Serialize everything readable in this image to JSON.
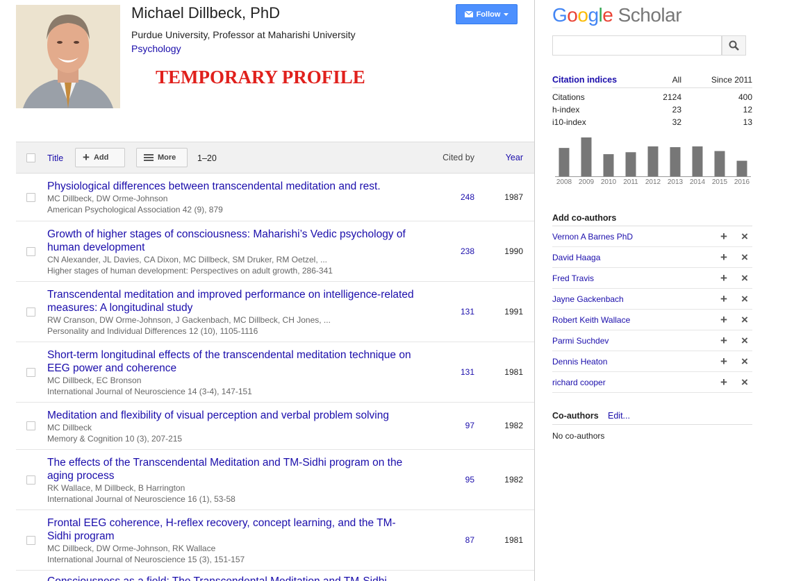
{
  "profile": {
    "name": "Michael Dillbeck, PhD",
    "affiliation": "Purdue University, Professor at Maharishi University",
    "interest": "Psychology",
    "overlay_text": "TEMPORARY PROFILE",
    "follow_label": "Follow"
  },
  "table": {
    "col_title": "Title",
    "add_label": "Add",
    "more_label": "More",
    "range": "1–20",
    "col_cited": "Cited by",
    "col_year": "Year",
    "rows": [
      {
        "title": "Physiological differences between transcendental meditation and rest.",
        "authors": "MC Dillbeck, DW Orme-Johnson",
        "venue": "American Psychological Association 42 (9), 879",
        "cited": "248",
        "year": "1987"
      },
      {
        "title": "Growth of higher stages of consciousness: Maharishi’s Vedic psychology of human development",
        "authors": "CN Alexander, JL Davies, CA Dixon, MC Dillbeck, SM Druker, RM Oetzel, ...",
        "venue": "Higher stages of human development: Perspectives on adult growth, 286-341",
        "cited": "238",
        "year": "1990"
      },
      {
        "title": "Transcendental meditation and improved performance on intelligence-related measures: A longitudinal study",
        "authors": "RW Cranson, DW Orme-Johnson, J Gackenbach, MC Dillbeck, CH Jones, ...",
        "venue": "Personality and Individual Differences 12 (10), 1105-1116",
        "cited": "131",
        "year": "1991"
      },
      {
        "title": "Short-term longitudinal effects of the transcendental meditation technique on EEG power and coherence",
        "authors": "MC Dillbeck, EC Bronson",
        "venue": "International Journal of Neuroscience 14 (3-4), 147-151",
        "cited": "131",
        "year": "1981"
      },
      {
        "title": "Meditation and flexibility of visual perception and verbal problem solving",
        "authors": "MC Dillbeck",
        "venue": "Memory & Cognition 10 (3), 207-215",
        "cited": "97",
        "year": "1982"
      },
      {
        "title": "The effects of the Transcendental Meditation and TM-Sidhi program on the aging process",
        "authors": "RK Wallace, M Dillbeck, B Harrington",
        "venue": "International Journal of Neuroscience 16 (1), 53-58",
        "cited": "95",
        "year": "1982"
      },
      {
        "title": "Frontal EEG coherence, H-reflex recovery, concept learning, and the TM-Sidhi program",
        "authors": "MC Dillbeck, DW Orme-Johnson, RK Wallace",
        "venue": "International Journal of Neuroscience 15 (3), 151-157",
        "cited": "87",
        "year": "1981"
      },
      {
        "title": "Consciousness as a field: The Transcendental Meditation and TM-Sidhi",
        "authors": "",
        "venue": "",
        "cited": "",
        "year": ""
      }
    ]
  },
  "sidebar": {
    "logo_google": "Google",
    "logo_scholar": "Scholar",
    "citation_indices": {
      "header": "Citation indices",
      "col_all": "All",
      "col_since": "Since 2011",
      "rows": [
        {
          "label": "Citations",
          "all": "2124",
          "since": "400"
        },
        {
          "label": "h-index",
          "all": "23",
          "since": "12"
        },
        {
          "label": "i10-index",
          "all": "32",
          "since": "13"
        }
      ]
    },
    "add_coauthors_title": "Add co-authors",
    "suggested_coauthors": [
      "Vernon A Barnes PhD",
      "David Haaga",
      "Fred Travis",
      "Jayne Gackenbach",
      "Robert Keith Wallace",
      "Parmi Suchdev",
      "Dennis Heaton",
      "richard cooper"
    ],
    "coauthors_title": "Co-authors",
    "coauthors_edit": "Edit...",
    "no_coauthors": "No co-authors"
  },
  "chart_data": {
    "type": "bar",
    "categories": [
      "2008",
      "2009",
      "2010",
      "2011",
      "2012",
      "2013",
      "2014",
      "2015",
      "2016"
    ],
    "values": [
      73,
      100,
      57,
      62,
      77,
      75,
      77,
      65,
      40
    ],
    "bar_color": "#777777"
  },
  "colors": {
    "link": "#1a0dab",
    "follow_blue": "#4d90fe",
    "overlay_red": "#e0201c"
  }
}
